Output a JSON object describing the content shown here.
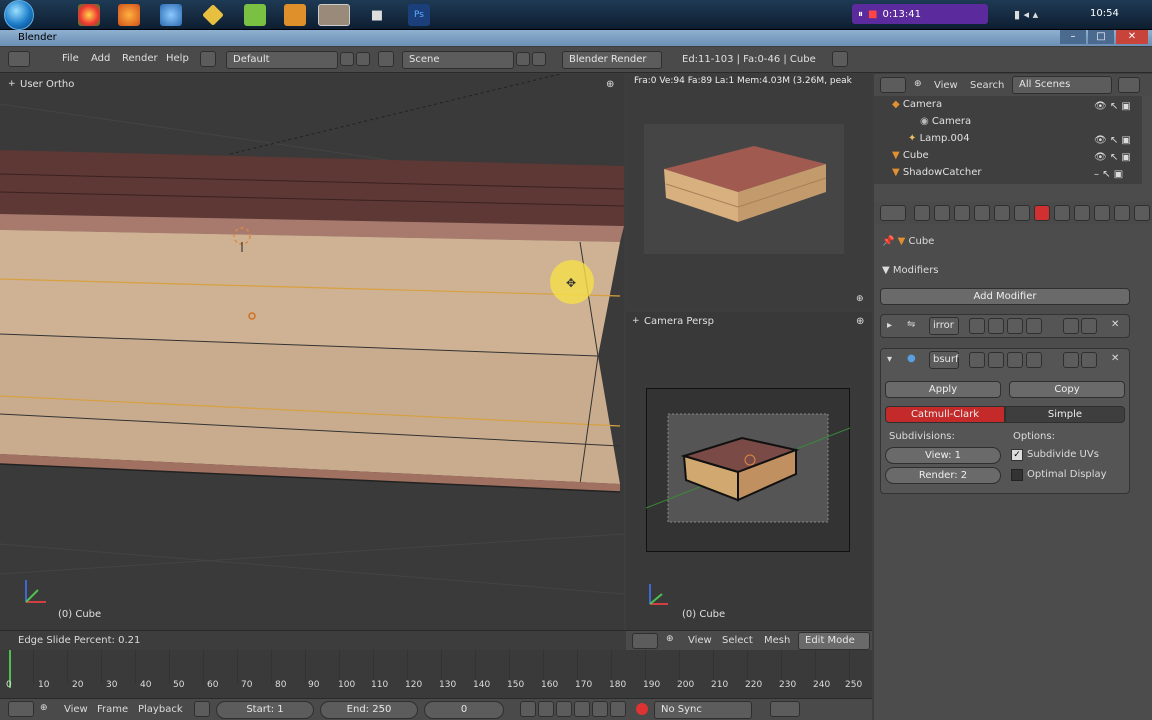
{
  "taskbar": {
    "recording_time": "0:13:41",
    "clock": "10:54"
  },
  "window": {
    "title": "Blender"
  },
  "infobar": {
    "menus": [
      "File",
      "Add",
      "Render",
      "Help"
    ],
    "layout": "Default",
    "scene": "Scene",
    "engine": "Blender Render",
    "stats": "Ed:11-103 | Fa:0-46 | Cube"
  },
  "viewport_main": {
    "label": "User Ortho",
    "object_label": "(0) Cube"
  },
  "render_preview": {
    "stats": "Fra:0  Ve:94 Fa:89 La:1 Mem:4.03M (3.26M, peak"
  },
  "camera_view": {
    "label": "Camera Persp",
    "object_label": "(0) Cube"
  },
  "status": {
    "operation": "Edge Slide Percent: 0.21"
  },
  "view3d_header": {
    "menus": [
      "View",
      "Select",
      "Mesh"
    ],
    "mode": "Edit Mode"
  },
  "timeline": {
    "ticks": [
      "0",
      "10",
      "20",
      "30",
      "40",
      "50",
      "60",
      "70",
      "80",
      "90",
      "100",
      "110",
      "120",
      "130",
      "140",
      "150",
      "160",
      "170",
      "180",
      "190",
      "200",
      "210",
      "220",
      "230",
      "240",
      "250"
    ],
    "menus": [
      "View",
      "Frame",
      "Playback"
    ],
    "start": "Start: 1",
    "end": "End: 250",
    "current": "0",
    "sync": "No Sync"
  },
  "outliner": {
    "menus": [
      "View",
      "Search"
    ],
    "filter": "All Scenes",
    "items": [
      {
        "label": "Camera"
      },
      {
        "label": "Camera"
      },
      {
        "label": "Lamp.004"
      },
      {
        "label": "Cube"
      },
      {
        "label": "ShadowCatcher"
      }
    ]
  },
  "properties": {
    "breadcrumb": "Cube",
    "section": "Modifiers",
    "add_modifier": "Add Modifier",
    "modifiers": [
      {
        "name": "irror"
      },
      {
        "name": "bsurf"
      }
    ],
    "apply": "Apply",
    "copy": "Copy",
    "subdiv_types": [
      "Catmull-Clark",
      "Simple"
    ],
    "subdivisions_label": "Subdivisions:",
    "options_label": "Options:",
    "view_levels": "View: 1",
    "render_levels": "Render: 2",
    "subdivide_uvs": "Subdivide UVs",
    "optimal_display": "Optimal Display"
  }
}
